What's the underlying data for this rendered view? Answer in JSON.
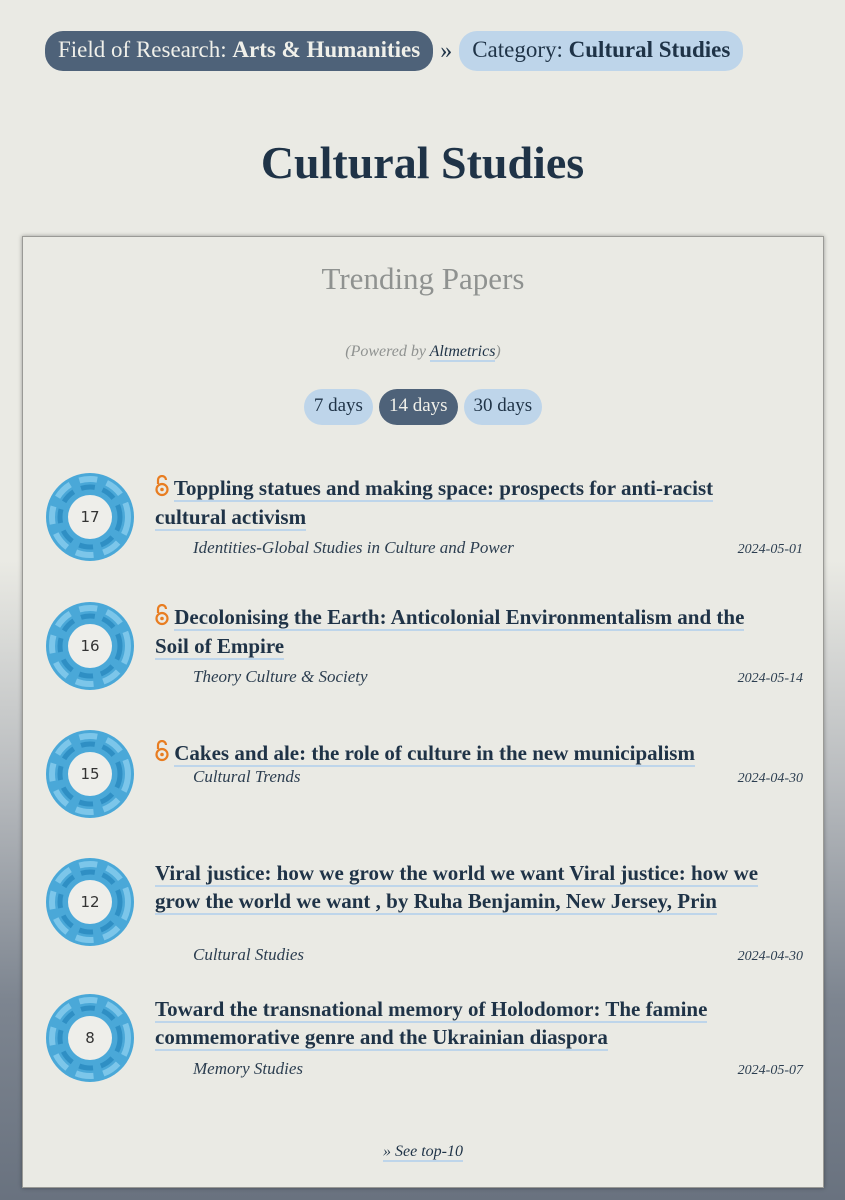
{
  "breadcrumb": {
    "field_prefix": "Field of Research: ",
    "field_value": "Arts & Humanities",
    "separator": "»",
    "category_prefix": "Category: ",
    "category_value": "Cultural Studies"
  },
  "page_title": "Cultural Studies",
  "panel": {
    "title": "Trending Papers",
    "powered_prefix": "(Powered by ",
    "powered_link": "Altmetrics",
    "powered_suffix": ")",
    "tabs": [
      {
        "label": "7 days",
        "active": false
      },
      {
        "label": "14 days",
        "active": true
      },
      {
        "label": "30 days",
        "active": false
      }
    ],
    "see_top": "» See top-10"
  },
  "colors": {
    "accent_dark": "#4e6279",
    "accent_light": "#bed5ea",
    "open_access": "#e87d21",
    "badge_blue": "#4aa8d8"
  },
  "papers": [
    {
      "score": "17",
      "open_access": true,
      "title": "Toppling statues and making space: prospects for anti-racist cultural activism",
      "journal": "Identities-Global Studies in Culture and Power",
      "date": "2024-05-01"
    },
    {
      "score": "16",
      "open_access": true,
      "title": "Decolonising the Earth: Anticolonial Environmentalism and the Soil of Empire",
      "journal": "Theory Culture & Society",
      "date": "2024-05-14"
    },
    {
      "score": "15",
      "open_access": true,
      "title": "Cakes and ale: the role of culture in the new municipalism",
      "journal": "Cultural Trends",
      "date": "2024-04-30"
    },
    {
      "score": "12",
      "open_access": false,
      "title": "Viral justice: how we grow the world we want Viral justice: how we grow the world we want , by Ruha Benjamin, New Jersey, Prin",
      "journal": "Cultural Studies",
      "date": "2024-04-30"
    },
    {
      "score": "8",
      "open_access": false,
      "title": "Toward the transnational memory of Holodomor: The famine commemorative genre and the Ukrainian diaspora",
      "journal": "Memory Studies",
      "date": "2024-05-07"
    }
  ]
}
